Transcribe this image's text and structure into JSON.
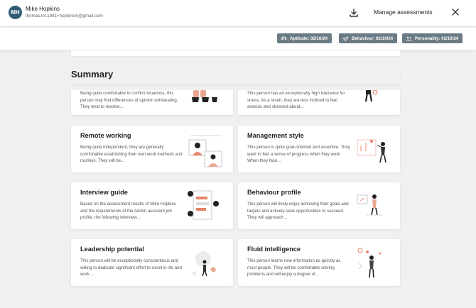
{
  "user": {
    "initials": "MH",
    "name": "Mike Hopkins",
    "email": "thomas.int.1981+hopkinsm@gmail.com"
  },
  "header": {
    "manage_label": "Manage assessments"
  },
  "badges": [
    {
      "label": "Aptitude: 02/10/24",
      "icon": "brain-icon"
    },
    {
      "label": "Behaviour: 02/10/24",
      "icon": "send-icon"
    },
    {
      "label": "Personality: 02/10/24",
      "icon": "people-icon"
    }
  ],
  "colors": {
    "avatar": "#2f5d73",
    "badge": "#6b7b86",
    "accent": "#e8846b",
    "background": "#f0f0f0"
  },
  "summary": {
    "title": "Summary",
    "partial_cards": [
      {
        "desc": "Being quite comfortable in conflict situations, this person may find differences of opinion exhilarating. They tend to resolve..."
      },
      {
        "desc": "This person has an exceptionally high tolerance for stress. As a result, they are less inclined to feel anxious and stressed about..."
      }
    ],
    "cards": [
      {
        "title": "Remote working",
        "desc": "Being quite independent, they are generally comfortable establishing their own work methods and routines. They will be..."
      },
      {
        "title": "Management style",
        "desc": "This person is quite goal-oriented and assertive. They want to feel a sense of progress when they work. When they face..."
      },
      {
        "title": "Interview guide",
        "desc": "Based on the assessment results of Mike Hopkins and the requirements of the Admin assistant job profile, the following interview..."
      },
      {
        "title": "Behaviour profile",
        "desc": "This person will likely enjoy achieving their goals and targets and actively seek opportunities to succeed. They will approach..."
      },
      {
        "title": "Leadership potential",
        "desc": "This person will be exceptionally conscientious and willing to dedicate significant effort to excel in life and work...."
      },
      {
        "title": "Fluid intelligence",
        "desc": "This person learns new information as quickly as most people. They will be comfortable solving problems and will enjoy a degree of..."
      }
    ]
  }
}
